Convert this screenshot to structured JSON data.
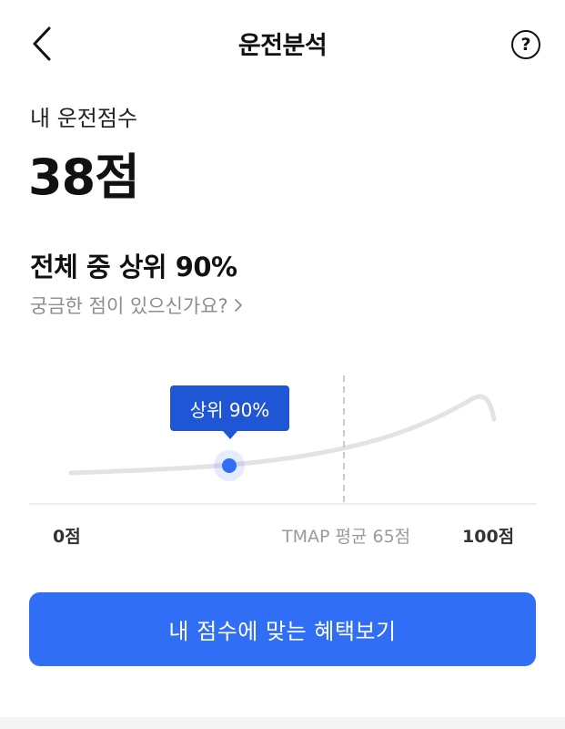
{
  "header": {
    "title": "운전분석",
    "back_icon": "chevron-left-icon",
    "help_label": "?"
  },
  "score": {
    "label": "내 운전점수",
    "value": "38점"
  },
  "ranking": {
    "text": "전체 중 상위 90%",
    "question_link": "궁금한 점이 있으신가요?"
  },
  "chart_data": {
    "type": "line",
    "x_range": [
      0,
      100
    ],
    "marker": {
      "score": 38,
      "label": "상위 90%"
    },
    "average": {
      "score": 65
    },
    "tick_labels": {
      "min": "0점",
      "average": "TMAP 평균 65점",
      "max": "100점"
    },
    "colors": {
      "curve": "#e3e3e3",
      "marker": "#2f6ef5",
      "tooltip": "#1f56d6"
    }
  },
  "cta": {
    "label": "내 점수에 맞는 혜택보기",
    "color": "#2f6ef5"
  }
}
